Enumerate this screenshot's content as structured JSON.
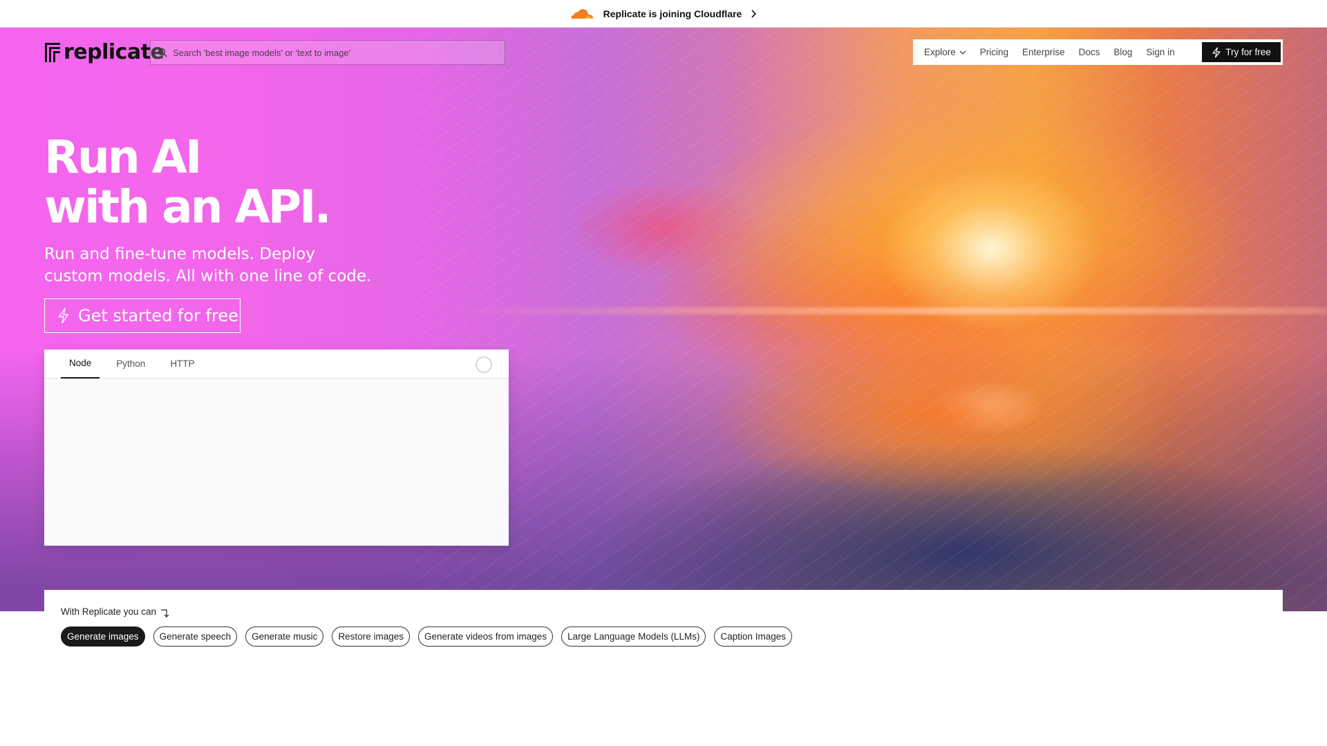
{
  "announcement": {
    "text": "Replicate is joining Cloudflare"
  },
  "nav": {
    "logo_text": "replicate",
    "search_placeholder": "Search 'best image models' or 'text to image'",
    "links": [
      "Explore",
      "Pricing",
      "Enterprise",
      "Docs",
      "Blog",
      "Sign in"
    ],
    "try_button": "Try for free"
  },
  "hero": {
    "headline_line1": "Run AI",
    "headline_line2": "with an API.",
    "subhead_line1": "Run and fine-tune models. Deploy",
    "subhead_line2": "custom models. All with one line of code.",
    "cta": "Get started for free"
  },
  "code_panel": {
    "tabs": [
      "Node",
      "Python",
      "HTTP"
    ],
    "active_tab": "Node"
  },
  "capabilities": {
    "intro": "With Replicate you can",
    "chips": [
      "Generate images",
      "Generate speech",
      "Generate music",
      "Restore images",
      "Generate videos from images",
      "Large Language Models (LLMs)",
      "Caption Images"
    ],
    "active_chip": "Generate images"
  },
  "colors": {
    "cloudflare_orange": "#f38020",
    "button_dark": "#111111",
    "hero_pink": "#f565ef",
    "hero_orange": "#f6a145"
  }
}
